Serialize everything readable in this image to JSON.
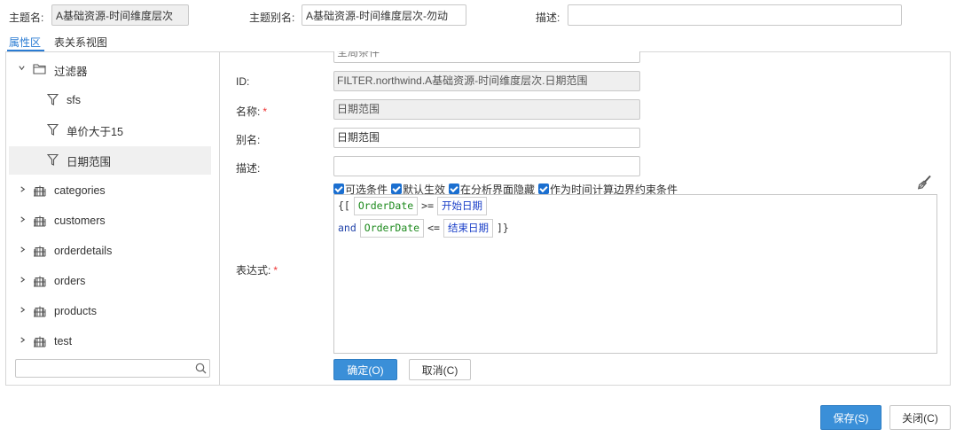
{
  "header": {
    "topic_name_label": "主题名:",
    "topic_name_value": "A基础资源-时间维度层次",
    "topic_alias_label": "主题别名:",
    "topic_alias_value": "A基础资源-时间维度层次-勿动",
    "description_label": "描述:",
    "description_value": ""
  },
  "tabs": [
    {
      "label": "属性区",
      "active": true
    },
    {
      "label": "表关系视图",
      "active": false
    }
  ],
  "tree": {
    "filter_group": {
      "label": "过滤器",
      "expanded": true
    },
    "filters": [
      {
        "label": "sfs"
      },
      {
        "label": "单价大于15"
      },
      {
        "label": "日期范围",
        "selected": true
      }
    ],
    "tables": [
      {
        "label": "categories"
      },
      {
        "label": "customers"
      },
      {
        "label": "orderdetails"
      },
      {
        "label": "orders"
      },
      {
        "label": "products"
      },
      {
        "label": "test"
      }
    ],
    "search_placeholder": ""
  },
  "form": {
    "top_clipped_value": "全局条件",
    "id_label": "ID:",
    "id_value": "FILTER.northwind.A基础资源-时间维度层次.日期范围",
    "name_label": "名称:",
    "name_value": "日期范围",
    "alias_label": "别名:",
    "alias_value": "日期范围",
    "desc_label": "描述:",
    "desc_value": "",
    "expr_label": "表达式:",
    "required_mark": "*",
    "checkboxes": [
      {
        "label": "可选条件",
        "checked": true
      },
      {
        "label": "默认生效",
        "checked": true
      },
      {
        "label": "在分析界面隐藏",
        "checked": true
      },
      {
        "label": "作为时间计算边界约束条件",
        "checked": true
      }
    ],
    "expression": {
      "line1": {
        "open": "{[",
        "field": "OrderDate",
        "op": ">=",
        "param": "开始日期"
      },
      "line2": {
        "kw": "and",
        "field": "OrderDate",
        "op": "<=",
        "param": "结束日期",
        "close": "]}"
      }
    },
    "ok_label": "确定(O)",
    "cancel_label": "取消(C)"
  },
  "footer": {
    "save_label": "保存(S)",
    "close_label": "关闭(C)"
  },
  "colors": {
    "accent": "#2b7cd3",
    "primary_button": "#3a8fd8",
    "field_token": "#1d8a1d",
    "param_token": "#1a3fc8",
    "required": "#e33333"
  }
}
